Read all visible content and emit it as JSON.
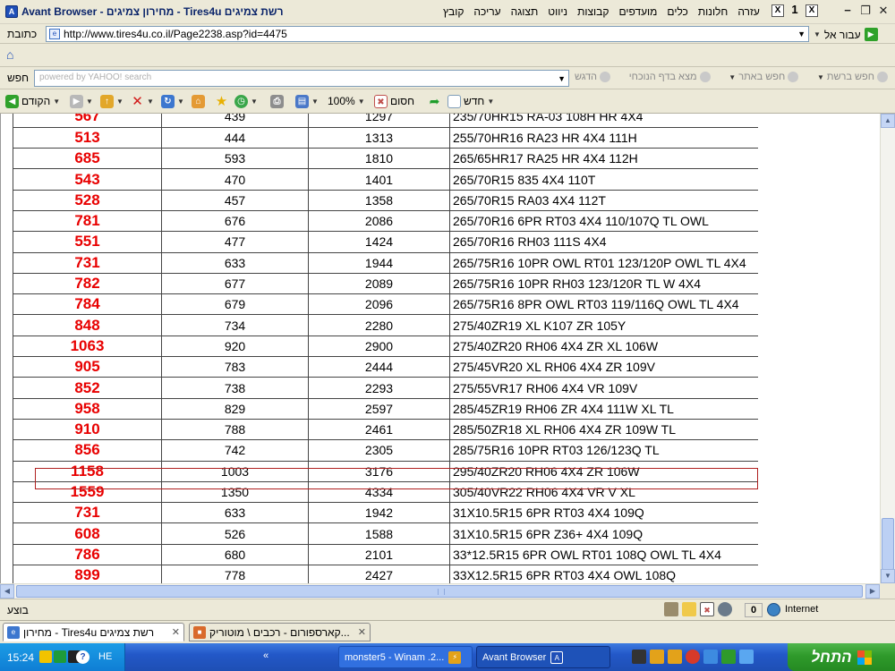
{
  "window": {
    "title": "Avant Browser - מחירון צמיגים - Tires4u רשת צמיגים",
    "menu": [
      "קובץ",
      "עריכה",
      "תצוגה",
      "ניווט",
      "קבוצות",
      "מועדפים",
      "כלים",
      "חלונות",
      "עזרה"
    ],
    "mdi_buttons": [
      "X",
      "1",
      "X"
    ]
  },
  "address": {
    "label": "כתובת",
    "url": "http://www.tires4u.co.il/Page2238.asp?id=4475",
    "go_label": "עבור אל"
  },
  "search": {
    "label": "חפש",
    "placeholder": "powered by YAHOO! search",
    "tools": [
      "חפש ברשת",
      "חפש באתר",
      "מצא בדף הנוכחי",
      "הדגש"
    ]
  },
  "toolbar": {
    "back_label": "הקודם",
    "zoom": "100%",
    "block_label": "חסום",
    "new_label": "חדש"
  },
  "table": {
    "rows": [
      {
        "price": "567",
        "a": "439",
        "b": "1297",
        "desc": "235/70HR15 RA-03 108H HR 4X4"
      },
      {
        "price": "513",
        "a": "444",
        "b": "1313",
        "desc": "255/70HR16 RA23 HR 4X4 111H"
      },
      {
        "price": "685",
        "a": "593",
        "b": "1810",
        "desc": "265/65HR17 RA25 HR 4X4 112H"
      },
      {
        "price": "543",
        "a": "470",
        "b": "1401",
        "desc": "265/70R15 835 4X4 110T"
      },
      {
        "price": "528",
        "a": "457",
        "b": "1358",
        "desc": "265/70R15 RA03 4X4 112T"
      },
      {
        "price": "781",
        "a": "676",
        "b": "2086",
        "desc": "265/70R16 6PR RT03 4X4 110/107Q TL OWL"
      },
      {
        "price": "551",
        "a": "477",
        "b": "1424",
        "desc": "265/70R16 RH03 111S 4X4"
      },
      {
        "price": "731",
        "a": "633",
        "b": "1944",
        "desc": "265/75R16 10PR OWL RT01 123/120P OWL TL 4X4"
      },
      {
        "price": "782",
        "a": "677",
        "b": "2089",
        "desc": "265/75R16 10PR RH03 123/120R TL W 4X4"
      },
      {
        "price": "784",
        "a": "679",
        "b": "2096",
        "desc": "265/75R16 8PR OWL RT03 119/116Q OWL TL 4X4"
      },
      {
        "price": "848",
        "a": "734",
        "b": "2280",
        "desc": "275/40ZR19 XL K107 ZR 105Y"
      },
      {
        "price": "1063",
        "a": "920",
        "b": "2900",
        "desc": "275/40ZR20 RH06 4X4 ZR XL 106W"
      },
      {
        "price": "905",
        "a": "783",
        "b": "2444",
        "desc": "275/45VR20 XL RH06 4X4 ZR 109V"
      },
      {
        "price": "852",
        "a": "738",
        "b": "2293",
        "desc": "275/55VR17 RH06 4X4 VR 109V"
      },
      {
        "price": "958",
        "a": "829",
        "b": "2597",
        "desc": "285/45ZR19 RH06 ZR 4X4 111W XL TL"
      },
      {
        "price": "910",
        "a": "788",
        "b": "2461",
        "desc": "285/50ZR18 XL RH06 4X4 ZR 109W TL"
      },
      {
        "price": "856",
        "a": "742",
        "b": "2305",
        "desc": "285/75R16 10PR RT03 126/123Q TL"
      },
      {
        "price": "1158",
        "a": "1003",
        "b": "3176",
        "desc": "295/40ZR20 RH06 4X4 ZR 106W"
      },
      {
        "price": "1559",
        "a": "1350",
        "b": "4334",
        "desc": "305/40VR22 RH06 4X4 VR V XL"
      },
      {
        "price": "731",
        "a": "633",
        "b": "1942",
        "desc": "31X10.5R15 6PR RT03 4X4 109Q"
      },
      {
        "price": "608",
        "a": "526",
        "b": "1588",
        "desc": "31X10.5R15 6PR Z36+ 4X4  109Q"
      },
      {
        "price": "786",
        "a": "680",
        "b": "2101",
        "desc": "33*12.5R15 6PR OWL RT01 108Q OWL TL 4X4"
      },
      {
        "price": "899",
        "a": "778",
        "b": "2427",
        "desc": "33X12.5R15 6PR RT03 4X4 OWL 108Q"
      }
    ]
  },
  "status": {
    "text": "בוצע",
    "count": "0",
    "zone": "Internet"
  },
  "tabs": [
    {
      "label": "מחירון - Tires4u רשת צמיגים"
    },
    {
      "label": "קארספורום - רכבים \\ מוטוריק..."
    }
  ],
  "taskbar": {
    "clock": "15:24",
    "language": "HE",
    "tasks": [
      "monster5 - Winam .2...",
      "Avant Browser"
    ],
    "start_label": "התחל"
  },
  "colors": {
    "price_red": "#e80000",
    "selected_row_border": "#b02020",
    "taskbar_blue": "#2358c8",
    "start_green": "#2f9a2b"
  }
}
